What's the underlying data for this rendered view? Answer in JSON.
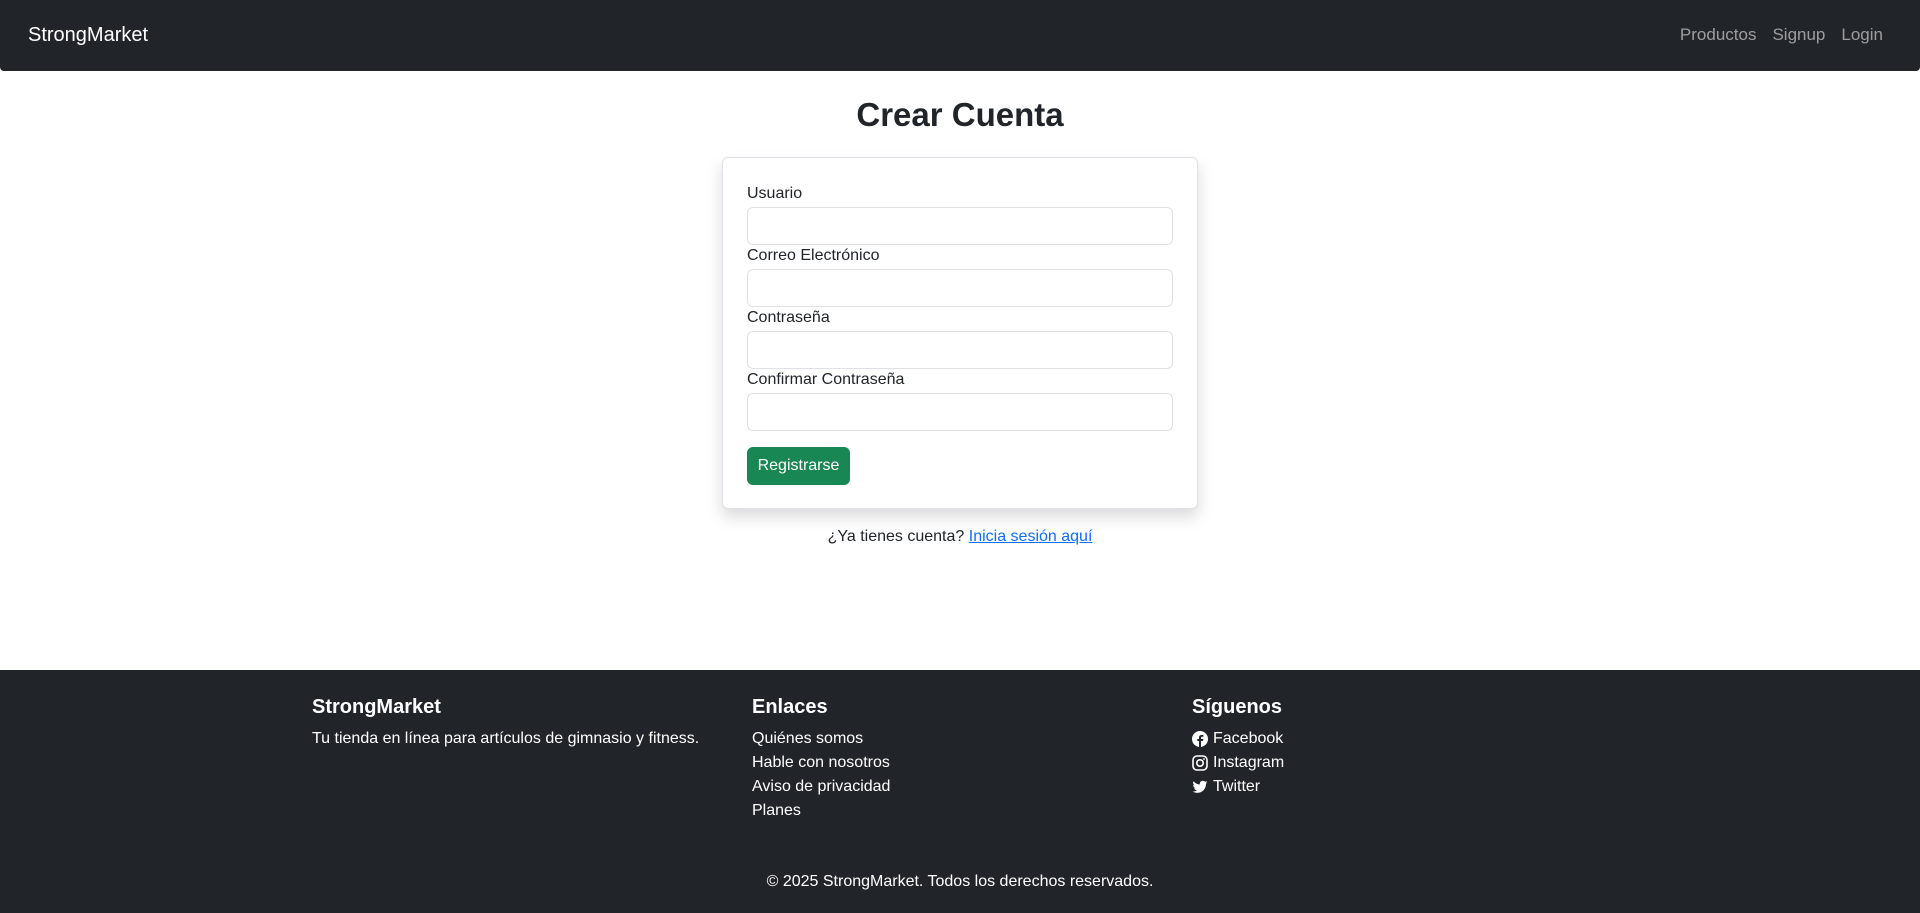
{
  "navbar": {
    "brand": "StrongMarket",
    "links": [
      "Productos",
      "Signup",
      "Login"
    ]
  },
  "page": {
    "title": "Crear Cuenta"
  },
  "form": {
    "fields": [
      {
        "label": "Usuario",
        "value": ""
      },
      {
        "label": "Correo Electrónico",
        "value": ""
      },
      {
        "label": "Contraseña",
        "value": ""
      },
      {
        "label": "Confirmar Contraseña",
        "value": ""
      }
    ],
    "submit_label": "Registrarse"
  },
  "login_prompt": {
    "text": "¿Ya tienes cuenta?",
    "link": "Inicia sesión aquí"
  },
  "footer": {
    "about": {
      "heading": "StrongMarket",
      "text": "Tu tienda en línea para artículos de gimnasio y fitness."
    },
    "links": {
      "heading": "Enlaces",
      "items": [
        "Quiénes somos",
        "Hable con nosotros",
        "Aviso de privacidad",
        "Planes"
      ]
    },
    "social": {
      "heading": "Síguenos",
      "items": [
        {
          "label": "Facebook",
          "icon": "facebook-icon"
        },
        {
          "label": "Instagram",
          "icon": "instagram-icon"
        },
        {
          "label": "Twitter",
          "icon": "twitter-icon"
        }
      ]
    },
    "copyright": "© 2025 StrongMarket. Todos los derechos reservados."
  },
  "colors": {
    "navbar_bg": "#212529",
    "primary_button": "#198754",
    "link": "#0d6efd"
  }
}
